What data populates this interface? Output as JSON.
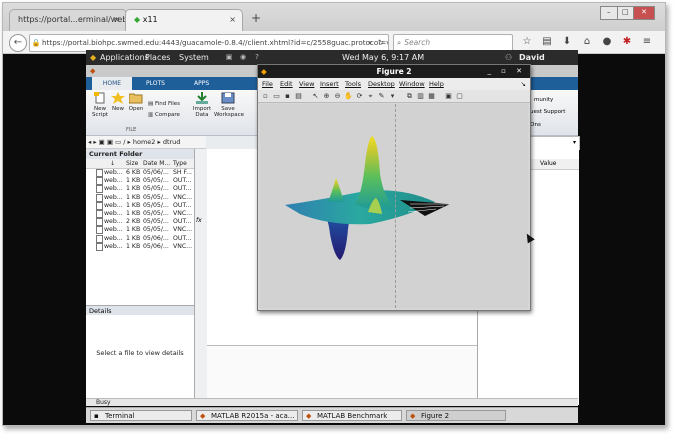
{
  "browser": {
    "tabs": [
      {
        "label": "https://portal...erminal/webgui/",
        "close": "×"
      },
      {
        "label": "x11",
        "close": "×"
      }
    ],
    "new_tab": "+",
    "url": "https://portal.biohpc.swmed.edu:4443/guacamole-0.8.4//client.xhtml?id=c/2558guac.protocol=vnc&guac.host",
    "search_placeholder": "Search",
    "icons": [
      "star-icon",
      "clipboard-icon",
      "download-icon",
      "home-icon",
      "chat-icon",
      "settings-icon",
      "menu-icon"
    ]
  },
  "desktop": {
    "menu": {
      "applications": "Applications",
      "places": "Places",
      "system": "System"
    },
    "clock": "Wed May 6, 9:17 AM",
    "user": "David Trudgian"
  },
  "matlab": {
    "ribbon_tabs": {
      "home": "HOME",
      "plots": "PLOTS",
      "apps": "APPS"
    },
    "buttons": {
      "new_script": "New\nScript",
      "new": "New",
      "open": "Open",
      "find_files": "Find Files",
      "compare": "Compare",
      "import_data": "Import\nData",
      "save_workspace": "Save\nWorkspace",
      "file_section": "FILE",
      "community": "munity",
      "request_support": "uest Support",
      "addons": "-Ons"
    },
    "path": "/ ▸ home2 ▸ dtrud",
    "current_folder": {
      "title": "Current Folder",
      "columns": {
        "name": "↓",
        "size": "Size",
        "date": "Date M...",
        "type": "Type"
      },
      "files": [
        {
          "name": "web...",
          "size": "6 KB",
          "date": "05/06/...",
          "type": "SH F..."
        },
        {
          "name": "web...",
          "size": "1 KB",
          "date": "05/05/...",
          "type": "OUT..."
        },
        {
          "name": "web...",
          "size": "1 KB",
          "date": "05/05/...",
          "type": "OUT..."
        },
        {
          "name": "web...",
          "size": "1 KB",
          "date": "05/05/...",
          "type": "VNC..."
        },
        {
          "name": "web...",
          "size": "1 KB",
          "date": "05/05/...",
          "type": "OUT..."
        },
        {
          "name": "web...",
          "size": "1 KB",
          "date": "05/05/...",
          "type": "VNC..."
        },
        {
          "name": "web...",
          "size": "2 KB",
          "date": "05/05/...",
          "type": "OUT..."
        },
        {
          "name": "web...",
          "size": "1 KB",
          "date": "05/05/...",
          "type": "VNC..."
        },
        {
          "name": "web...",
          "size": "1 KB",
          "date": "05/06/...",
          "type": "OUT..."
        },
        {
          "name": "web...",
          "size": "1 KB",
          "date": "05/06/...",
          "type": "VNC..."
        }
      ]
    },
    "details": {
      "title": "Details",
      "message": "Select a file to view details"
    },
    "workspace": {
      "value_column": "Value"
    },
    "status": "Busy"
  },
  "figure": {
    "title": "Figure 2",
    "menu": [
      "File",
      "Edit",
      "View",
      "Insert",
      "Tools",
      "Desktop",
      "Window",
      "Help"
    ],
    "toolbar_icons": [
      "new-icon",
      "open-icon",
      "save-icon",
      "print-icon",
      "pointer-icon",
      "zoom-in-icon",
      "zoom-out-icon",
      "pan-icon",
      "rotate-icon",
      "datacursor-icon",
      "brush-icon",
      "link-icon",
      "colorbar-icon",
      "legend-icon",
      "hide-tools-icon",
      "show-tools-icon"
    ]
  },
  "taskbar": [
    {
      "label": "Terminal"
    },
    {
      "label": "MATLAB R2015a - aca..."
    },
    {
      "label": "MATLAB Benchmark"
    },
    {
      "label": "Figure 2"
    }
  ]
}
